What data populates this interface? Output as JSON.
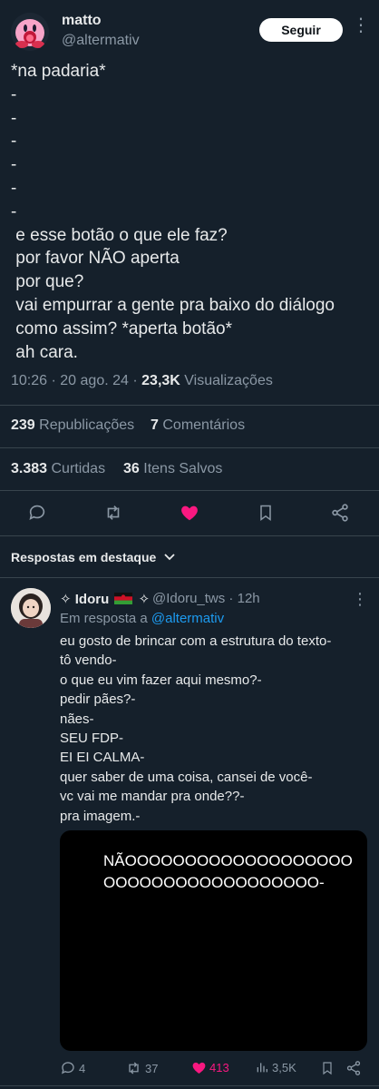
{
  "tweet": {
    "display_name": "matto",
    "handle": "@altermativ",
    "follow_label": "Seguir",
    "text": "*na padaria*\n-\n-\n-\n-\n-\n-\n e esse botão o que ele faz?\n por favor NÃO aperta\n por que?\n vai empurrar a gente pra baixo do diálogo\n como assim? *aperta botão*\n ah cara.",
    "time": "10:26",
    "date": "20 ago. 24",
    "views_count": "23,3K",
    "views_label": "Visualizações",
    "reposts_count": "239",
    "reposts_label": "Republicações",
    "comments_count": "7",
    "comments_label": "Comentários",
    "likes_count": "3.383",
    "likes_label": "Curtidas",
    "saves_count": "36",
    "saves_label": "Itens Salvos",
    "liked_color": "#f91880"
  },
  "highlights_label": "Respostas em destaque",
  "reply": {
    "display_name": "✧ Idoru",
    "name_suffix": "✧",
    "handle": "@Idoru_tws",
    "time": "12h",
    "replying_prefix": "Em resposta a",
    "replying_to": "@altermativ",
    "text": "eu gosto de brincar com a estrutura do texto-\ntô vendo-\no que eu vim fazer aqui mesmo?-\npedir pães?-\nnães-\nSEU FDP-\nEI EI CALMA-\nquer saber de uma coisa, cansei de você-\nvc vai me mandar pra onde??-\npra imagem.-",
    "media_text": "NÃOOOOOOOOOOOOOOOOOOO\nOOOOOOOOOOOOOOOOOO-",
    "replies": "4",
    "reposts": "37",
    "likes": "413",
    "views": "3,5K"
  },
  "icons": {
    "reply": "speech-bubble-icon",
    "repost": "repost-arrows-icon",
    "like": "heart-icon",
    "bookmark": "bookmark-icon",
    "share": "share-icon",
    "views": "bar-chart-icon",
    "more": "more-dots-icon",
    "chevron": "chevron-down-icon"
  }
}
